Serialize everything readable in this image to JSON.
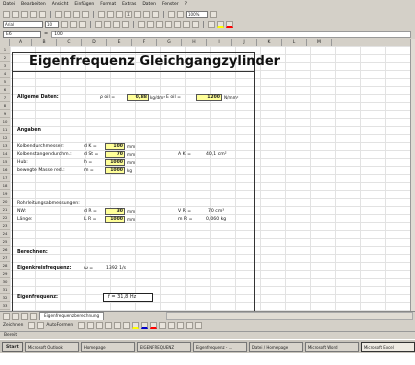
{
  "menubar": [
    "Datei",
    "Bearbeiten",
    "Ansicht",
    "Einfügen",
    "Format",
    "Extras",
    "Daten",
    "Fenster",
    "?"
  ],
  "toolbar1": {
    "zoom": "100%",
    "sigma": "Σ"
  },
  "toolbar2": {
    "font": "Arial",
    "size": "10"
  },
  "formulabar": {
    "name_box": "E6",
    "fx": "=",
    "content": "100"
  },
  "columns": [
    "A",
    "B",
    "C",
    "D",
    "E",
    "F",
    "G",
    "H",
    "I",
    "J",
    "K",
    "L",
    "M"
  ],
  "rows": [
    "1",
    "2",
    "3",
    "4",
    "5",
    "6",
    "7",
    "8",
    "9",
    "10",
    "11",
    "12",
    "13",
    "14",
    "15",
    "16",
    "17",
    "18",
    "19",
    "20",
    "21",
    "22",
    "23",
    "24",
    "25",
    "26",
    "27",
    "28",
    "29",
    "30",
    "31",
    "32",
    "33"
  ],
  "sheet": {
    "title": "Eigenfrequenz Gleichgangzylinder",
    "allgemeine": {
      "label": "Allgeme Daten:",
      "rho_sym": "ρ oil =",
      "rho_val": "0,88",
      "rho_unit": "kg/dm³",
      "e_sym": "E oil =",
      "e_val": "1200",
      "e_unit": "N/mm²"
    },
    "angaben": {
      "label": "Angaben",
      "rows": [
        {
          "label": "Kolbendurchmesser:",
          "sym": "d K =",
          "val": "100",
          "unit": "mm"
        },
        {
          "label": "Kolbenstangendurchm.:",
          "sym": "d St =",
          "val": "70",
          "unit": "mm"
        },
        {
          "label": "Hub:",
          "sym": "h =",
          "val": "1000",
          "unit": "mm"
        },
        {
          "label": "bewegte Masse red.:",
          "sym": "m =",
          "val": "1000",
          "unit": "kg"
        }
      ],
      "ak_sym": "A K =",
      "ak_val": "40,1 cm²"
    },
    "rohr": {
      "label": "Rohrleitungsabmessungen:",
      "rows": [
        {
          "label": "NW:",
          "sym": "d R =",
          "val": "30",
          "unit": "mm"
        },
        {
          "label": "Länge:",
          "sym": "L R =",
          "val": "1000",
          "unit": "mm"
        }
      ],
      "vr_sym": "V R =",
      "vr_val": "70 cm³",
      "mr_sym": "m R =",
      "mr_val": "0,060 kg"
    },
    "berechnen": {
      "label": "Berechnen:",
      "ekf_label": "Eigenkreisfrequenz:",
      "ekf_sym": "ω =",
      "ekf_val": "1392 1/s"
    },
    "eigenfrequenz": {
      "label": "Eigenfrequenz:",
      "result": "f =   31,8 Hz"
    }
  },
  "sheettabs": [
    "Eigenfrequenzberechnung"
  ],
  "drawbar": {
    "label": "Zeichnen",
    "autoformen": "AutoFormen"
  },
  "statusbar": "Bereit",
  "taskbar": {
    "start": "Start",
    "items": [
      "Microsoft Outlook",
      "Homepage",
      "EIGENFREQUENZ",
      "Eigenfrequenz - ...",
      "Datei / Homepage",
      "Microsoft Word",
      "Microsoft Excel"
    ]
  }
}
